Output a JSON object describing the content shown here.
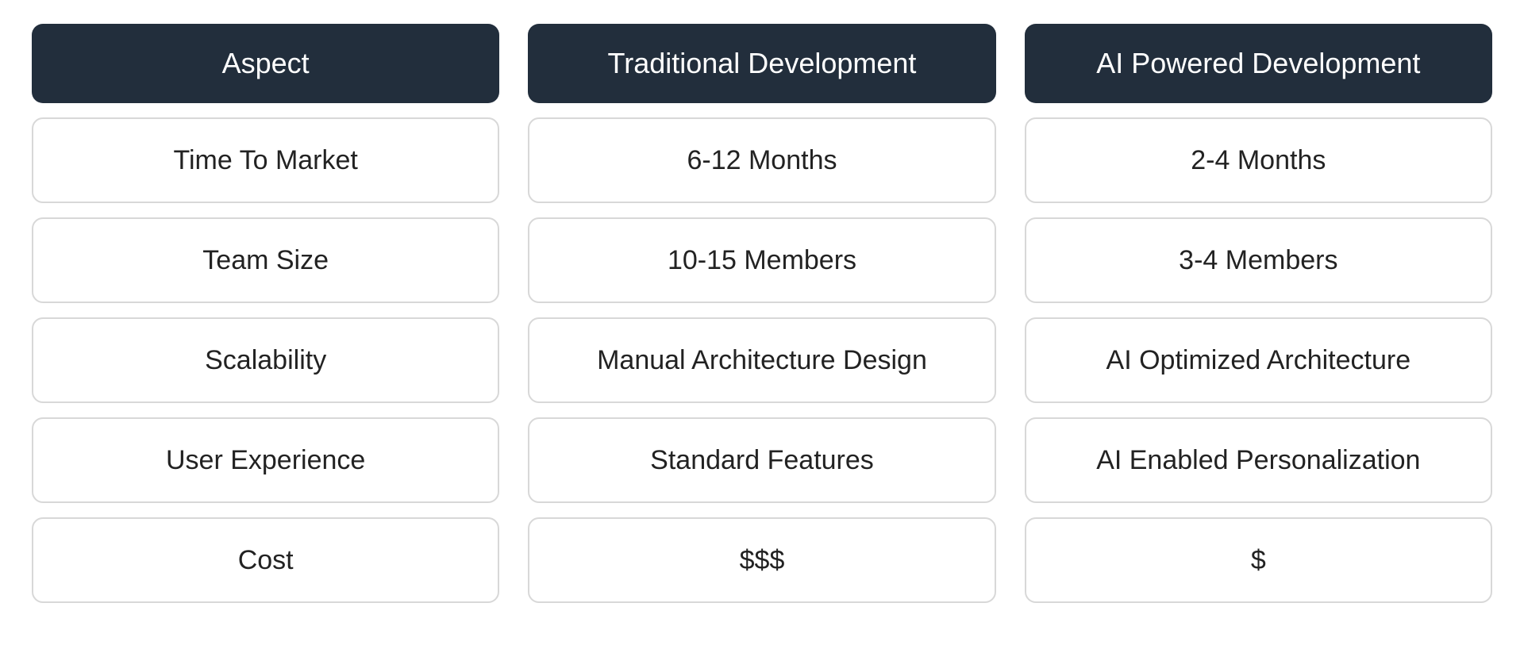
{
  "chart_data": {
    "type": "table",
    "title": "",
    "columns": [
      "Aspect",
      "Traditional Development",
      "AI Powered Development"
    ],
    "rows": [
      [
        "Time To Market",
        "6-12 Months",
        "2-4 Months"
      ],
      [
        "Team Size",
        "10-15 Members",
        "3-4 Members"
      ],
      [
        "Scalability",
        "Manual Architecture Design",
        "AI Optimized Architecture"
      ],
      [
        "User Experience",
        "Standard Features",
        "AI Enabled Personalization"
      ],
      [
        "Cost",
        "$$$",
        "$"
      ]
    ]
  },
  "colors": {
    "header_bg": "#222E3C",
    "header_text": "#ffffff",
    "cell_border": "#d8d8d8",
    "cell_text": "#222222"
  }
}
